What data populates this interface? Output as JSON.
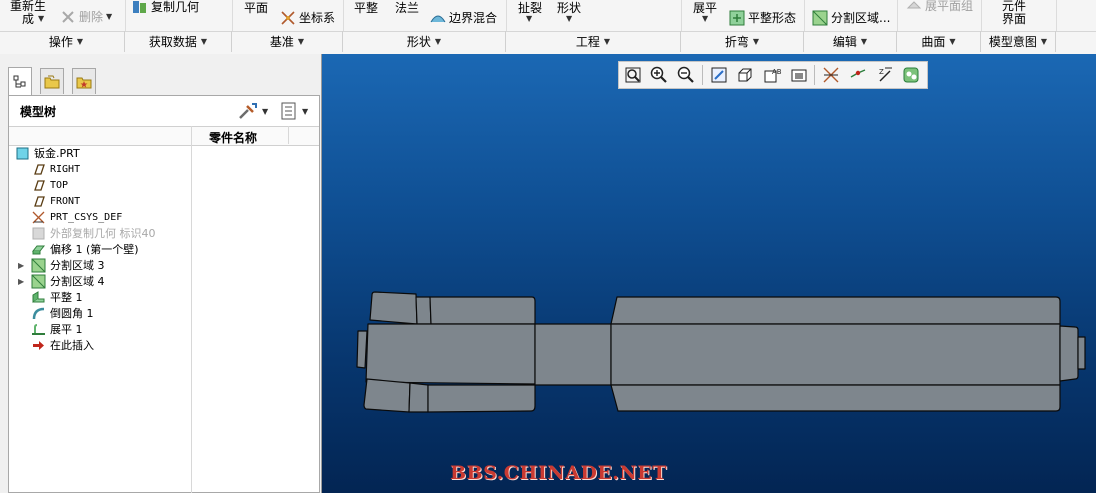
{
  "ribbon": {
    "regenerate_label": "重新生\n成",
    "delete_label": "删除",
    "copy_geometry_label": "复制几何",
    "plane_label": "平面",
    "coordinate_system_label": "坐标系",
    "flat_label": "平整",
    "flange_label": "法兰",
    "boundary_blend_label": "边界混合",
    "rip_label": "扯裂",
    "form_label": "形状",
    "unbend_label": "展平",
    "flat_state_label": "平整形态",
    "split_area_label": "分割区域...",
    "flatten_quilt_label": "展平面组",
    "component_interface_label": "元件\n界面",
    "groups": [
      "操作",
      "获取数据",
      "基准",
      "形状",
      "工程",
      "折弯",
      "编辑",
      "曲面",
      "模型意图"
    ]
  },
  "left_panel": {
    "tree_title": "模型树",
    "column_header": "零件名称",
    "tree": [
      {
        "label": "钣金.PRT",
        "icon": "part-icon",
        "expand": false,
        "indent": 0,
        "disabled": false,
        "mono": false
      },
      {
        "label": "RIGHT",
        "icon": "datum-plane-icon",
        "expand": false,
        "indent": 1,
        "disabled": false,
        "mono": true
      },
      {
        "label": "TOP",
        "icon": "datum-plane-icon",
        "expand": false,
        "indent": 1,
        "disabled": false,
        "mono": true
      },
      {
        "label": "FRONT",
        "icon": "datum-plane-icon",
        "expand": false,
        "indent": 1,
        "disabled": false,
        "mono": true
      },
      {
        "label": "PRT_CSYS_DEF",
        "icon": "csys-icon",
        "expand": false,
        "indent": 1,
        "disabled": false,
        "mono": true
      },
      {
        "label": "外部复制几何 标识40",
        "icon": "copy-geometry-icon",
        "expand": false,
        "indent": 1,
        "disabled": true,
        "mono": false
      },
      {
        "label": "偏移 1 (第一个壁)",
        "icon": "offset-wall-icon",
        "expand": false,
        "indent": 1,
        "disabled": false,
        "mono": false
      },
      {
        "label": "分割区域 3",
        "icon": "split-area-icon",
        "expand": true,
        "indent": 1,
        "disabled": false,
        "mono": false
      },
      {
        "label": "分割区域 4",
        "icon": "split-area-icon",
        "expand": true,
        "indent": 1,
        "disabled": false,
        "mono": false
      },
      {
        "label": "平整 1",
        "icon": "flat-wall-icon",
        "expand": false,
        "indent": 1,
        "disabled": false,
        "mono": false
      },
      {
        "label": "倒圆角 1",
        "icon": "round-icon",
        "expand": false,
        "indent": 1,
        "disabled": false,
        "mono": false
      },
      {
        "label": "展平 1",
        "icon": "unbend-icon",
        "expand": false,
        "indent": 1,
        "disabled": false,
        "mono": false
      },
      {
        "label": "在此插入",
        "icon": "insert-here-icon",
        "expand": false,
        "indent": 1,
        "disabled": false,
        "mono": false
      }
    ]
  },
  "viewport": {
    "watermark": "BBS.CHINADE.NET",
    "toolbar_icons": [
      "refit-icon",
      "zoom-in-icon",
      "zoom-out-icon",
      "repaint-icon",
      "display-style-icon",
      "saved-orientations-icon",
      "view-manager-icon",
      "datum-display-icon",
      "point-display-icon",
      "csys-display-icon",
      "annotation-display-icon"
    ]
  },
  "colors": {
    "viewport_top": "#1b68b4",
    "viewport_bottom": "#032553",
    "part_fill": "#7e868d",
    "part_edge": "#0a0a0a",
    "watermark": "#c93a32"
  }
}
